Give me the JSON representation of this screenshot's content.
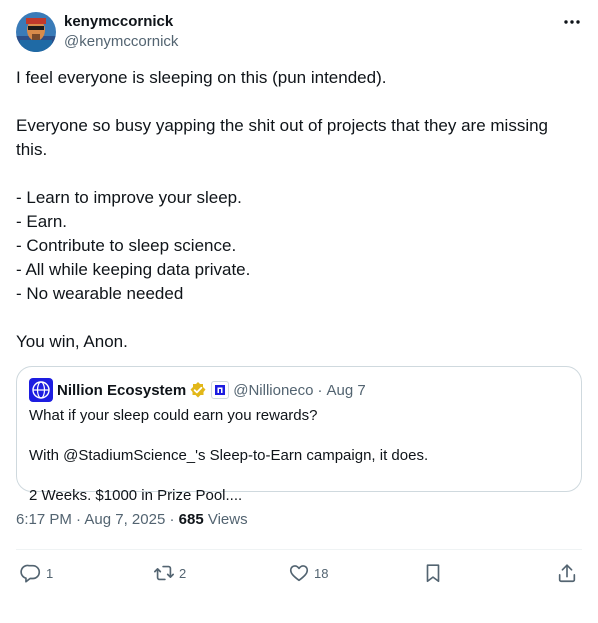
{
  "author": {
    "display_name": "kenymccornick",
    "handle": "@kenymccornick",
    "avatar_icon": "portrait-avatar"
  },
  "post": {
    "text": "I feel everyone is sleeping on this (pun intended).\n\nEveryone so busy yapping the shit out of projects that they are missing this.\n\n- Learn to improve your sleep.\n- Earn.\n- Contribute to sleep science.\n- All while keeping data private.\n- No wearable needed\n\nYou win, Anon."
  },
  "quote": {
    "display_name": "Nillion Ecosystem",
    "handle": "@Nillioneco",
    "separator": "·",
    "date": "Aug 7",
    "text": "What if your sleep could earn you rewards?\n\nWith @StadiumScience_'s Sleep-to-Earn campaign, it does.\n\n2 Weeks. $1000 in Prize Pool...."
  },
  "meta": {
    "time": "6:17 PM",
    "sep1": "·",
    "date": "Aug 7, 2025",
    "sep2": "·",
    "views_count": "685",
    "views_label": "Views"
  },
  "actions": {
    "replies": "1",
    "reposts": "2",
    "likes": "18"
  },
  "colors": {
    "text": "#0f1419",
    "secondary": "#536471",
    "border": "#cfd9de",
    "verified_gold": "#e2b719",
    "brand_blue": "#1d1de0"
  }
}
